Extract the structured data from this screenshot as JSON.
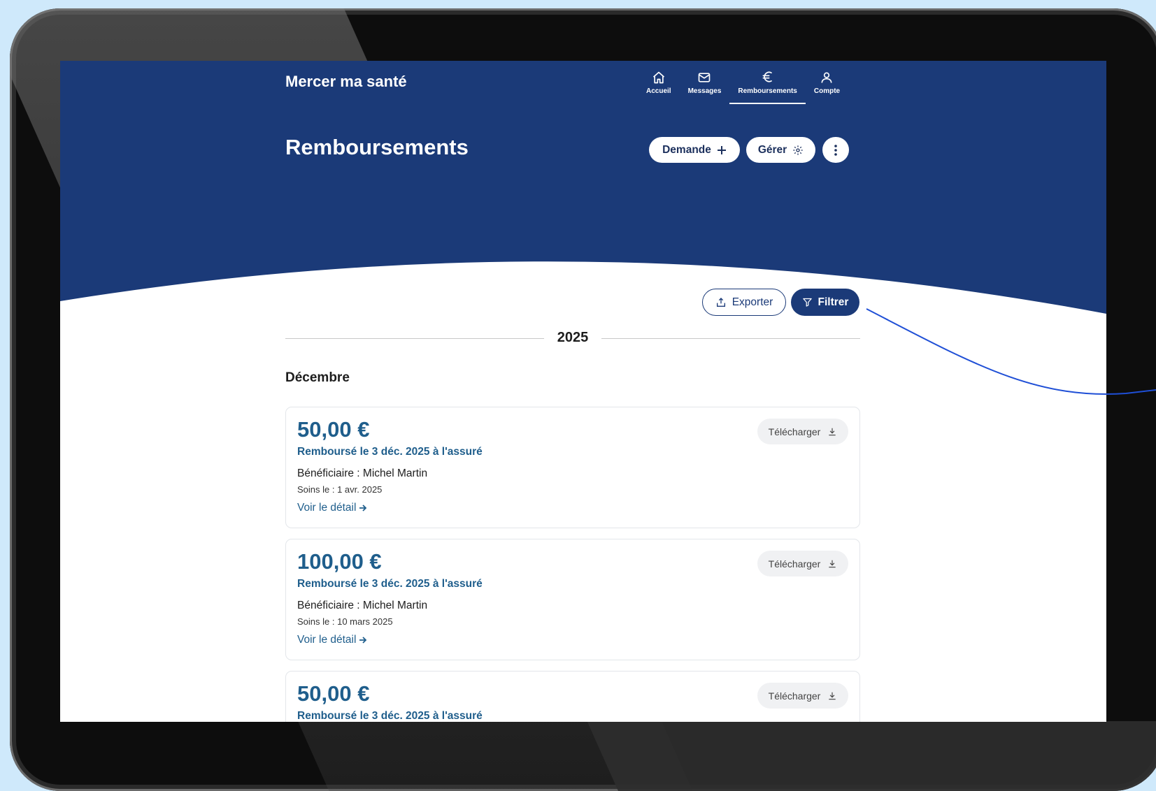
{
  "app": {
    "brand": "Mercer ma santé"
  },
  "nav": [
    {
      "label": "Accueil",
      "icon": "home-icon"
    },
    {
      "label": "Messages",
      "icon": "mail-icon"
    },
    {
      "label": "Remboursements",
      "icon": "euro-icon",
      "active": true
    },
    {
      "label": "Compte",
      "icon": "user-icon"
    }
  ],
  "page": {
    "title": "Remboursements"
  },
  "actions": {
    "demande_label": "Demande",
    "gerer_label": "Gérer",
    "more_icon": "more-vertical-icon"
  },
  "toolbar": {
    "export_label": "Exporter",
    "filter_label": "Filtrer"
  },
  "timeline": {
    "year": "2025",
    "month": "Décembre"
  },
  "cards": [
    {
      "amount": "50,00 €",
      "refund": "Remboursé le 3 déc. 2025 à l'assuré",
      "beneficiary": "Bénéficiaire : Michel Martin",
      "care_date": "Soins le : 1 avr. 2025",
      "detail_label": "Voir le détail",
      "download_label": "Télécharger"
    },
    {
      "amount": "100,00 €",
      "refund": "Remboursé le 3 déc. 2025 à l'assuré",
      "beneficiary": "Bénéficiaire : Michel Martin",
      "care_date": "Soins le : 10 mars 2025",
      "detail_label": "Voir le détail",
      "download_label": "Télécharger"
    },
    {
      "amount": "50,00 €",
      "refund": "Remboursé le 3 déc. 2025 à l'assuré",
      "beneficiary": "",
      "care_date": "",
      "detail_label": "",
      "download_label": "Télécharger"
    }
  ],
  "colors": {
    "brand_blue": "#1b3a78",
    "amount_blue": "#1f5e8c",
    "annotation_line": "#1f4fd6"
  }
}
